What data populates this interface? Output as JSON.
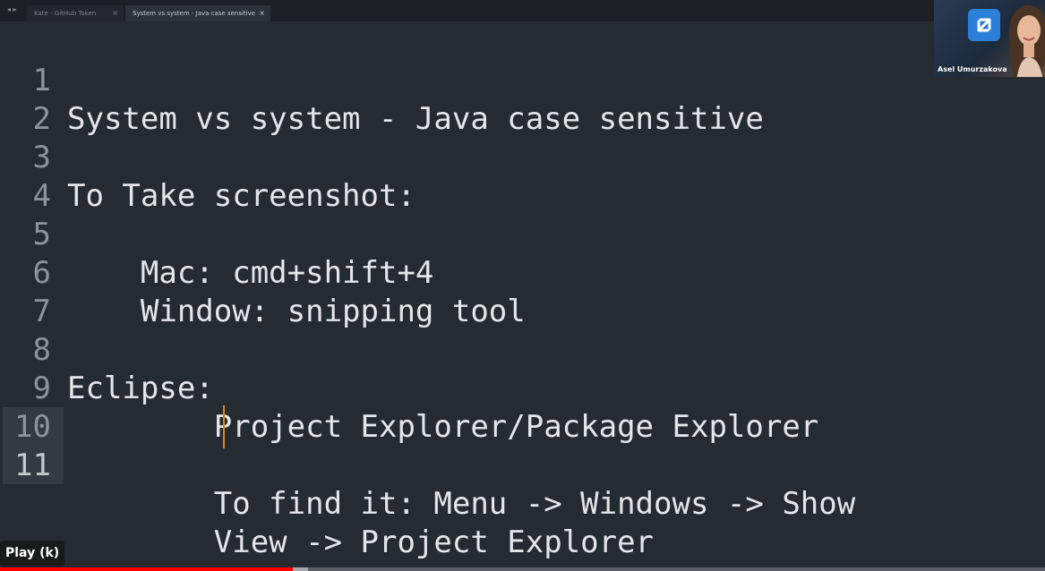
{
  "tabs": [
    {
      "title": "Kate - GitHub Token"
    },
    {
      "title": "System vs system - Java case sensitive"
    }
  ],
  "editor": {
    "current_line": "11",
    "lines": [
      {
        "num": "1",
        "text": "System vs system - Java case sensitive"
      },
      {
        "num": "2",
        "text": ""
      },
      {
        "num": "3",
        "text": "To Take screenshot:"
      },
      {
        "num": "4",
        "text": ""
      },
      {
        "num": "5",
        "text": "    Mac: cmd+shift+4"
      },
      {
        "num": "6",
        "text": "    Window: snipping tool"
      },
      {
        "num": "7",
        "text": ""
      },
      {
        "num": "8",
        "text": "Eclipse:"
      },
      {
        "num": "9",
        "text": "        Project Explorer/Package Explorer"
      },
      {
        "num": "10",
        "text": ""
      },
      {
        "num": "11",
        "text": "        To find it: Menu -> Windows -> Show"
      },
      {
        "num": "",
        "text": "        View -> Project Explorer"
      }
    ]
  },
  "presenter": {
    "name": "Asel Umurzakova"
  },
  "player": {
    "tooltip": "Play (k)",
    "progress_played_pct": 28,
    "progress_buffered_pct": 29.5,
    "accent_color": "#ff0000"
  }
}
